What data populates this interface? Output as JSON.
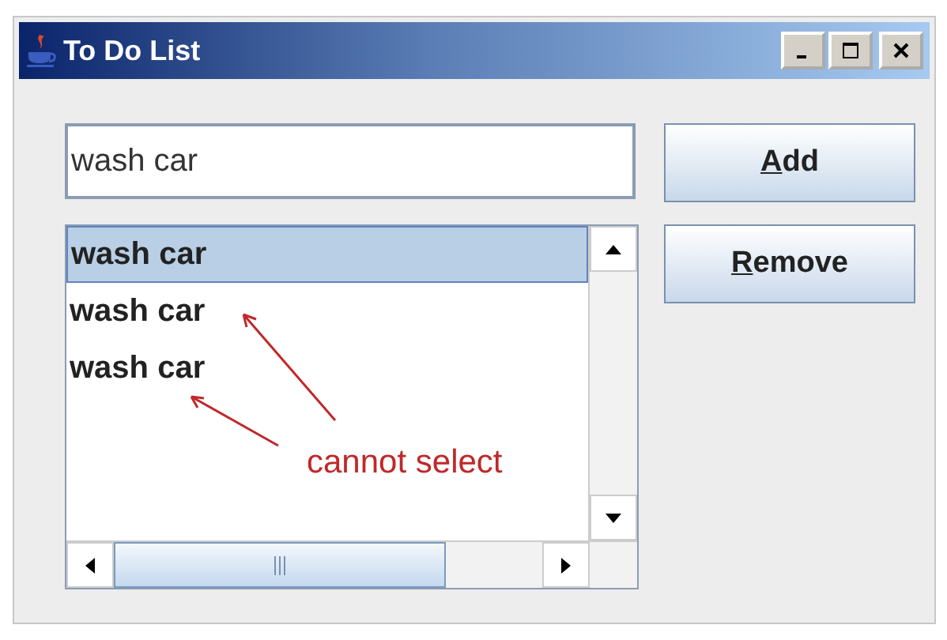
{
  "window": {
    "title": "To Do List"
  },
  "input": {
    "value": "wash car"
  },
  "buttons": [
    {
      "label": "Add"
    },
    {
      "label": "Remove"
    }
  ],
  "list": {
    "items": [
      {
        "label": "wash car",
        "selected": true
      },
      {
        "label": "wash car",
        "selected": false
      },
      {
        "label": "wash car",
        "selected": false
      }
    ]
  },
  "annotation": {
    "text": "cannot select"
  }
}
